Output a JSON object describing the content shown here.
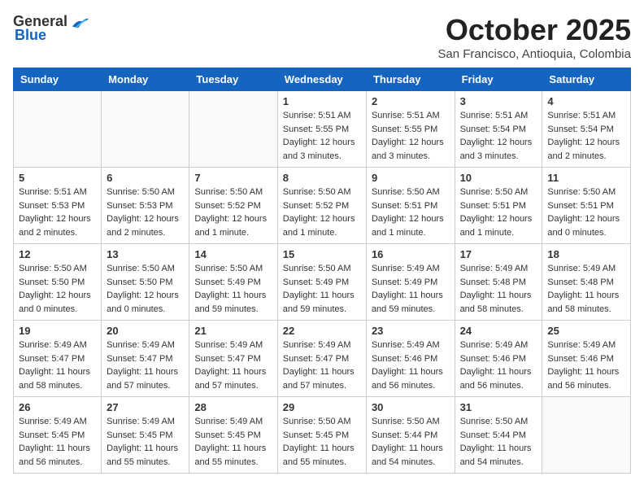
{
  "header": {
    "logo_general": "General",
    "logo_blue": "Blue",
    "month": "October 2025",
    "location": "San Francisco, Antioquia, Colombia"
  },
  "days_of_week": [
    "Sunday",
    "Monday",
    "Tuesday",
    "Wednesday",
    "Thursday",
    "Friday",
    "Saturday"
  ],
  "weeks": [
    [
      {
        "day": "",
        "empty": true
      },
      {
        "day": "",
        "empty": true
      },
      {
        "day": "",
        "empty": true
      },
      {
        "day": "1",
        "sunrise": "Sunrise: 5:51 AM",
        "sunset": "Sunset: 5:55 PM",
        "daylight": "Daylight: 12 hours and 3 minutes."
      },
      {
        "day": "2",
        "sunrise": "Sunrise: 5:51 AM",
        "sunset": "Sunset: 5:55 PM",
        "daylight": "Daylight: 12 hours and 3 minutes."
      },
      {
        "day": "3",
        "sunrise": "Sunrise: 5:51 AM",
        "sunset": "Sunset: 5:54 PM",
        "daylight": "Daylight: 12 hours and 3 minutes."
      },
      {
        "day": "4",
        "sunrise": "Sunrise: 5:51 AM",
        "sunset": "Sunset: 5:54 PM",
        "daylight": "Daylight: 12 hours and 2 minutes."
      }
    ],
    [
      {
        "day": "5",
        "sunrise": "Sunrise: 5:51 AM",
        "sunset": "Sunset: 5:53 PM",
        "daylight": "Daylight: 12 hours and 2 minutes."
      },
      {
        "day": "6",
        "sunrise": "Sunrise: 5:50 AM",
        "sunset": "Sunset: 5:53 PM",
        "daylight": "Daylight: 12 hours and 2 minutes."
      },
      {
        "day": "7",
        "sunrise": "Sunrise: 5:50 AM",
        "sunset": "Sunset: 5:52 PM",
        "daylight": "Daylight: 12 hours and 1 minute."
      },
      {
        "day": "8",
        "sunrise": "Sunrise: 5:50 AM",
        "sunset": "Sunset: 5:52 PM",
        "daylight": "Daylight: 12 hours and 1 minute."
      },
      {
        "day": "9",
        "sunrise": "Sunrise: 5:50 AM",
        "sunset": "Sunset: 5:51 PM",
        "daylight": "Daylight: 12 hours and 1 minute."
      },
      {
        "day": "10",
        "sunrise": "Sunrise: 5:50 AM",
        "sunset": "Sunset: 5:51 PM",
        "daylight": "Daylight: 12 hours and 1 minute."
      },
      {
        "day": "11",
        "sunrise": "Sunrise: 5:50 AM",
        "sunset": "Sunset: 5:51 PM",
        "daylight": "Daylight: 12 hours and 0 minutes."
      }
    ],
    [
      {
        "day": "12",
        "sunrise": "Sunrise: 5:50 AM",
        "sunset": "Sunset: 5:50 PM",
        "daylight": "Daylight: 12 hours and 0 minutes."
      },
      {
        "day": "13",
        "sunrise": "Sunrise: 5:50 AM",
        "sunset": "Sunset: 5:50 PM",
        "daylight": "Daylight: 12 hours and 0 minutes."
      },
      {
        "day": "14",
        "sunrise": "Sunrise: 5:50 AM",
        "sunset": "Sunset: 5:49 PM",
        "daylight": "Daylight: 11 hours and 59 minutes."
      },
      {
        "day": "15",
        "sunrise": "Sunrise: 5:50 AM",
        "sunset": "Sunset: 5:49 PM",
        "daylight": "Daylight: 11 hours and 59 minutes."
      },
      {
        "day": "16",
        "sunrise": "Sunrise: 5:49 AM",
        "sunset": "Sunset: 5:49 PM",
        "daylight": "Daylight: 11 hours and 59 minutes."
      },
      {
        "day": "17",
        "sunrise": "Sunrise: 5:49 AM",
        "sunset": "Sunset: 5:48 PM",
        "daylight": "Daylight: 11 hours and 58 minutes."
      },
      {
        "day": "18",
        "sunrise": "Sunrise: 5:49 AM",
        "sunset": "Sunset: 5:48 PM",
        "daylight": "Daylight: 11 hours and 58 minutes."
      }
    ],
    [
      {
        "day": "19",
        "sunrise": "Sunrise: 5:49 AM",
        "sunset": "Sunset: 5:47 PM",
        "daylight": "Daylight: 11 hours and 58 minutes."
      },
      {
        "day": "20",
        "sunrise": "Sunrise: 5:49 AM",
        "sunset": "Sunset: 5:47 PM",
        "daylight": "Daylight: 11 hours and 57 minutes."
      },
      {
        "day": "21",
        "sunrise": "Sunrise: 5:49 AM",
        "sunset": "Sunset: 5:47 PM",
        "daylight": "Daylight: 11 hours and 57 minutes."
      },
      {
        "day": "22",
        "sunrise": "Sunrise: 5:49 AM",
        "sunset": "Sunset: 5:47 PM",
        "daylight": "Daylight: 11 hours and 57 minutes."
      },
      {
        "day": "23",
        "sunrise": "Sunrise: 5:49 AM",
        "sunset": "Sunset: 5:46 PM",
        "daylight": "Daylight: 11 hours and 56 minutes."
      },
      {
        "day": "24",
        "sunrise": "Sunrise: 5:49 AM",
        "sunset": "Sunset: 5:46 PM",
        "daylight": "Daylight: 11 hours and 56 minutes."
      },
      {
        "day": "25",
        "sunrise": "Sunrise: 5:49 AM",
        "sunset": "Sunset: 5:46 PM",
        "daylight": "Daylight: 11 hours and 56 minutes."
      }
    ],
    [
      {
        "day": "26",
        "sunrise": "Sunrise: 5:49 AM",
        "sunset": "Sunset: 5:45 PM",
        "daylight": "Daylight: 11 hours and 56 minutes."
      },
      {
        "day": "27",
        "sunrise": "Sunrise: 5:49 AM",
        "sunset": "Sunset: 5:45 PM",
        "daylight": "Daylight: 11 hours and 55 minutes."
      },
      {
        "day": "28",
        "sunrise": "Sunrise: 5:49 AM",
        "sunset": "Sunset: 5:45 PM",
        "daylight": "Daylight: 11 hours and 55 minutes."
      },
      {
        "day": "29",
        "sunrise": "Sunrise: 5:50 AM",
        "sunset": "Sunset: 5:45 PM",
        "daylight": "Daylight: 11 hours and 55 minutes."
      },
      {
        "day": "30",
        "sunrise": "Sunrise: 5:50 AM",
        "sunset": "Sunset: 5:44 PM",
        "daylight": "Daylight: 11 hours and 54 minutes."
      },
      {
        "day": "31",
        "sunrise": "Sunrise: 5:50 AM",
        "sunset": "Sunset: 5:44 PM",
        "daylight": "Daylight: 11 hours and 54 minutes."
      },
      {
        "day": "",
        "empty": true
      }
    ]
  ]
}
